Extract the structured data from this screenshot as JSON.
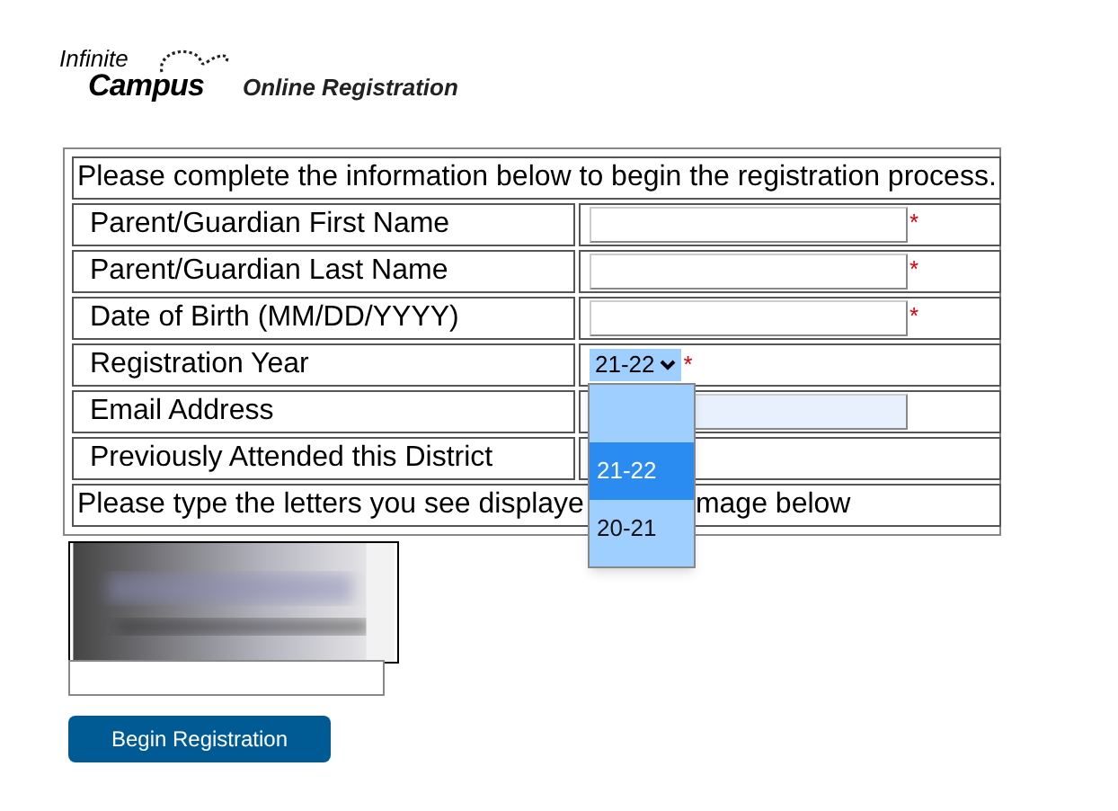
{
  "logo": {
    "line1": "Infinite",
    "line2": "Campus"
  },
  "app_title": "Online Registration",
  "form": {
    "intro": "Please complete the information below to begin the registration process.",
    "fields": [
      {
        "label": "Parent/Guardian First Name",
        "kind": "text",
        "required_mark": "*",
        "highlighted": false
      },
      {
        "label": "Parent/Guardian Last Name",
        "kind": "text",
        "required_mark": "*",
        "highlighted": false
      },
      {
        "label": "Date of Birth (MM/DD/YYYY)",
        "kind": "text",
        "required_mark": "*",
        "highlighted": false
      },
      {
        "label": "Registration Year",
        "kind": "select",
        "value": "21-22",
        "required_mark": "*",
        "expanded": true,
        "options": [
          {
            "label": "21-22",
            "selected": true
          },
          {
            "label": "20-21",
            "selected": false
          }
        ]
      },
      {
        "label": "Email Address",
        "kind": "text",
        "highlighted": true
      },
      {
        "label": "Previously Attended this District",
        "kind": "blank"
      }
    ],
    "captcha_prompt_before": "Please type the letters you see displaye",
    "captcha_prompt_after": "mage below"
  },
  "submit_button": "Begin Registration"
}
